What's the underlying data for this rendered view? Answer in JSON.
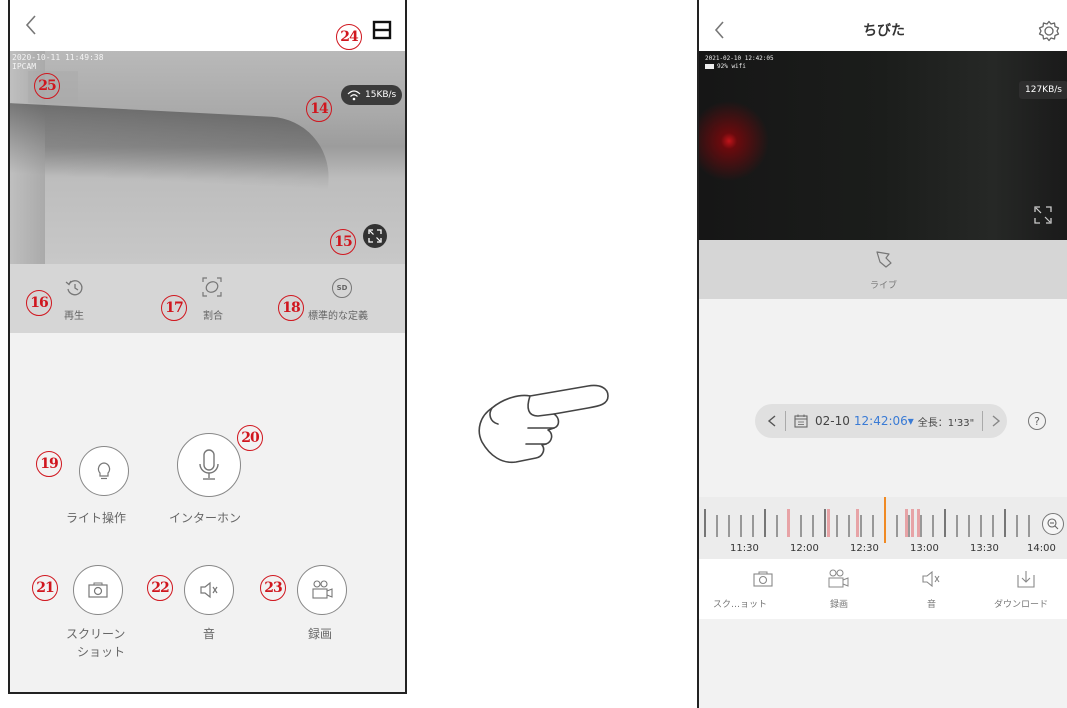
{
  "left": {
    "timestamp": "2020-10-11 11:49:38",
    "camera_name": "IPCAM",
    "speed": "15KB/s",
    "toolbar": {
      "playback_label": "再生",
      "ratio_label": "割合",
      "quality_label": "標準的な定義"
    },
    "controls": {
      "light_label": "ライト操作",
      "intercom_label": "インターホン",
      "screenshot_label_line1": "スクリーン",
      "screenshot_label_line2": "ショット",
      "sound_label": "音",
      "record_label": "録画"
    },
    "markers": {
      "m14": "14",
      "m15": "15",
      "m16": "16",
      "m17": "17",
      "m18": "18",
      "m19": "19",
      "m20": "20",
      "m21": "21",
      "m22": "22",
      "m23": "23",
      "m24": "24",
      "m25": "25"
    }
  },
  "right": {
    "title": "ちびた",
    "timestamp": "2021-02-10 12:42:05",
    "battery": "92% wifi",
    "speed": "127KB/s",
    "live_label": "ライブ",
    "date": "02-10",
    "time": "12:42:06▾",
    "duration": "全長：1'33\"",
    "help_icon_text": "?",
    "timeline_ticks": [
      "11:30",
      "12:00",
      "12:30",
      "13:00",
      "13:30",
      "14:00"
    ],
    "bottom": {
      "screenshot_label": "スク…ョット",
      "record_label": "録画",
      "sound_label": "音",
      "download_label": "ダウンロード"
    }
  },
  "colors": {
    "marker_red": "#d0161e",
    "toolbar_gray": "#d6d6d6",
    "time_blue": "#3a7bd5",
    "timeline_orange": "#f08a24"
  }
}
